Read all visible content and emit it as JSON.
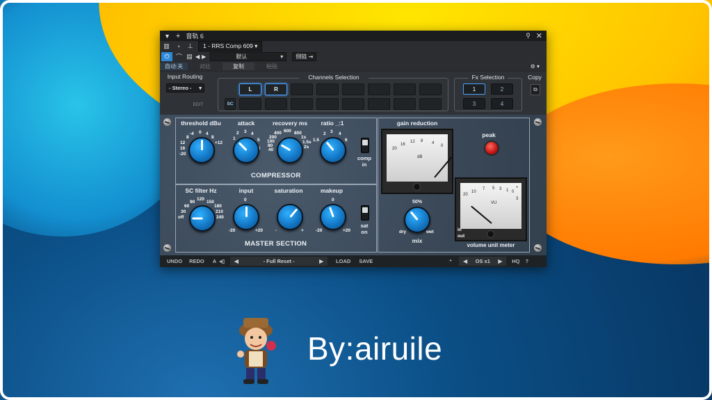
{
  "titlebar": {
    "track_name": "音轨 6",
    "add_icon": "plus-icon",
    "pin_icon": "pin-icon",
    "close_icon": "close-icon"
  },
  "toolbar1": {
    "plugin_select": "1 - RRS Comp 609"
  },
  "toolbar2": {
    "preset_value": "默认",
    "sidechain_label": "侧链"
  },
  "toolbar3": {
    "auto_off": "自动:关",
    "compare": "对比",
    "copy": "复制",
    "paste": "粘贴"
  },
  "routing": {
    "input_routing_label": "Input Routing",
    "input_routing_value": "- Stereo -",
    "edit_label": "EDIT",
    "channels_label": "Channels Selection",
    "channel_l": "L",
    "channel_r": "R",
    "sc_label": "SC",
    "fx_label": "Fx Selection",
    "fx_buttons": [
      "1",
      "2",
      "3",
      "4"
    ],
    "copy_label": "Copy"
  },
  "compressor": {
    "title": "COMPRESSOR",
    "threshold_label": "threshold dBu",
    "threshold_ticks": [
      "0",
      "4",
      "8",
      "+12",
      "-4",
      "8",
      "12",
      "16",
      "-20"
    ],
    "attack_label": "attack",
    "attack_ticks": [
      "1",
      "2",
      "3",
      "4",
      "5",
      "6"
    ],
    "recovery_label": "recovery ms",
    "recovery_ticks": [
      "400",
      "600",
      "800",
      "200",
      "1s",
      "100",
      "1.5s",
      "80",
      "2s",
      "40"
    ],
    "ratio_label": "ratio _:1",
    "ratio_ticks": [
      "2",
      "3",
      "4",
      "1.5",
      "6"
    ],
    "comp_toggle_label": "comp\nin"
  },
  "master": {
    "title": "MASTER SECTION",
    "scfilter_label": "SC filter Hz",
    "scfilter_ticks": [
      "120",
      "90",
      "150",
      "60",
      "180",
      "30",
      "210",
      "off",
      "240"
    ],
    "input_label": "input",
    "input_ticks": [
      "0",
      "-20",
      "+20"
    ],
    "saturation_label": "saturation",
    "saturation_ticks": [
      "-",
      "+"
    ],
    "makeup_label": "makeup",
    "makeup_ticks": [
      "0",
      "-20",
      "+20"
    ],
    "sat_toggle_label": "sat\non"
  },
  "gr": {
    "title": "gain reduction",
    "scale": [
      "20",
      "16",
      "12",
      "8",
      "4",
      "0"
    ],
    "unit": "dB",
    "peak_label": "peak",
    "mix_label": "mix",
    "mix_value": "50%",
    "mix_dry": "dry",
    "mix_wet": "wet"
  },
  "vu": {
    "title": "volume unit meter",
    "scale": [
      "20",
      "10",
      "7",
      "5",
      "3",
      "1",
      "0",
      "+",
      "3"
    ],
    "unit": "VU",
    "in_label": "in",
    "out_label": "out"
  },
  "bottom": {
    "undo": "UNDO",
    "redo": "REDO",
    "a_label": "A",
    "preset_name": "- Full Reset -",
    "load": "LOAD",
    "save": "SAVE",
    "os_value": "OS x1",
    "hq": "HQ",
    "help": "?"
  },
  "branding": {
    "signature": "By:airuile"
  },
  "colors": {
    "accent": "#2e88d8",
    "knob": "#1478c6",
    "panel": "#3d4c5c",
    "led": "#d32020"
  }
}
